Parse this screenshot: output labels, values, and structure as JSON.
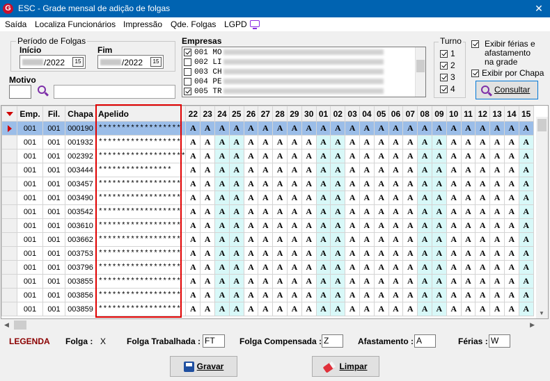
{
  "window": {
    "title": "ESC - Grade mensal de adição de folgas",
    "close": "✕"
  },
  "menu": [
    "Saída",
    "Localiza Funcionários",
    "Impressão",
    "Qde. Folgas",
    "LGPD"
  ],
  "periodo": {
    "title": "Período de Folgas",
    "inicio_label": "Início",
    "inicio_value": "/2022",
    "fim_label": "Fim",
    "fim_value": "/2022",
    "cal_label": "15"
  },
  "motivo": {
    "label": "Motivo"
  },
  "empresas": {
    "title": "Empresas",
    "items": [
      {
        "code": "001 MO",
        "checked": true
      },
      {
        "code": "002 LI",
        "checked": false
      },
      {
        "code": "003 CH",
        "checked": false
      },
      {
        "code": "004 PE",
        "checked": false
      },
      {
        "code": "005 TR",
        "checked": true
      }
    ]
  },
  "turno": {
    "title": "Turno",
    "items": [
      "1",
      "2",
      "3",
      "4"
    ]
  },
  "options": {
    "exibir_ferias": "Exibir férias e afastamento na grade",
    "exibir_chapa": "Exibir por Chapa"
  },
  "consultar_label": "Consultar",
  "grid": {
    "headers": [
      "Emp.",
      "Fil.",
      "Chapa",
      "Apelido"
    ],
    "days": [
      "22",
      "23",
      "24",
      "25",
      "26",
      "27",
      "28",
      "29",
      "30",
      "01",
      "02",
      "03",
      "04",
      "05",
      "06",
      "07",
      "08",
      "09",
      "10",
      "11",
      "12",
      "13",
      "14",
      "15"
    ],
    "tinted_days": [
      "24",
      "25",
      "01",
      "02",
      "08",
      "09",
      "15"
    ],
    "cell_value": "A",
    "rows": [
      {
        "emp": "001",
        "fil": "001",
        "chapa": "000190",
        "apelido": "******************"
      },
      {
        "emp": "001",
        "fil": "001",
        "chapa": "001932",
        "apelido": "******************"
      },
      {
        "emp": "001",
        "fil": "001",
        "chapa": "002392",
        "apelido": "*******************"
      },
      {
        "emp": "001",
        "fil": "001",
        "chapa": "003444",
        "apelido": "****************"
      },
      {
        "emp": "001",
        "fil": "001",
        "chapa": "003457",
        "apelido": "******************"
      },
      {
        "emp": "001",
        "fil": "001",
        "chapa": "003490",
        "apelido": "******************"
      },
      {
        "emp": "001",
        "fil": "001",
        "chapa": "003542",
        "apelido": "******************"
      },
      {
        "emp": "001",
        "fil": "001",
        "chapa": "003610",
        "apelido": "******************"
      },
      {
        "emp": "001",
        "fil": "001",
        "chapa": "003662",
        "apelido": "******************"
      },
      {
        "emp": "001",
        "fil": "001",
        "chapa": "003753",
        "apelido": "******************"
      },
      {
        "emp": "001",
        "fil": "001",
        "chapa": "003796",
        "apelido": "******************"
      },
      {
        "emp": "001",
        "fil": "001",
        "chapa": "003855",
        "apelido": "******************"
      },
      {
        "emp": "001",
        "fil": "001",
        "chapa": "003856",
        "apelido": "******************"
      },
      {
        "emp": "001",
        "fil": "001",
        "chapa": "003859",
        "apelido": "******************"
      }
    ]
  },
  "legenda": {
    "title": "LEGENDA",
    "folga_label": "Folga :",
    "folga_value": "X",
    "trab_label": "Folga Trabalhada :",
    "trab_value": "FT",
    "comp_label": "Folga Compensada :",
    "comp_value": "Z",
    "afast_label": "Afastamento :",
    "afast_value": "A",
    "ferias_label": "Férias :",
    "ferias_value": "W"
  },
  "buttons": {
    "gravar": "Gravar",
    "limpar": "Limpar"
  },
  "colors": {
    "titlebar": "#0063b1",
    "selected_row": "#9bbde8",
    "weekend_tint": "#d8f8f8",
    "highlight": "#e00000",
    "legend": "#8b0000"
  }
}
